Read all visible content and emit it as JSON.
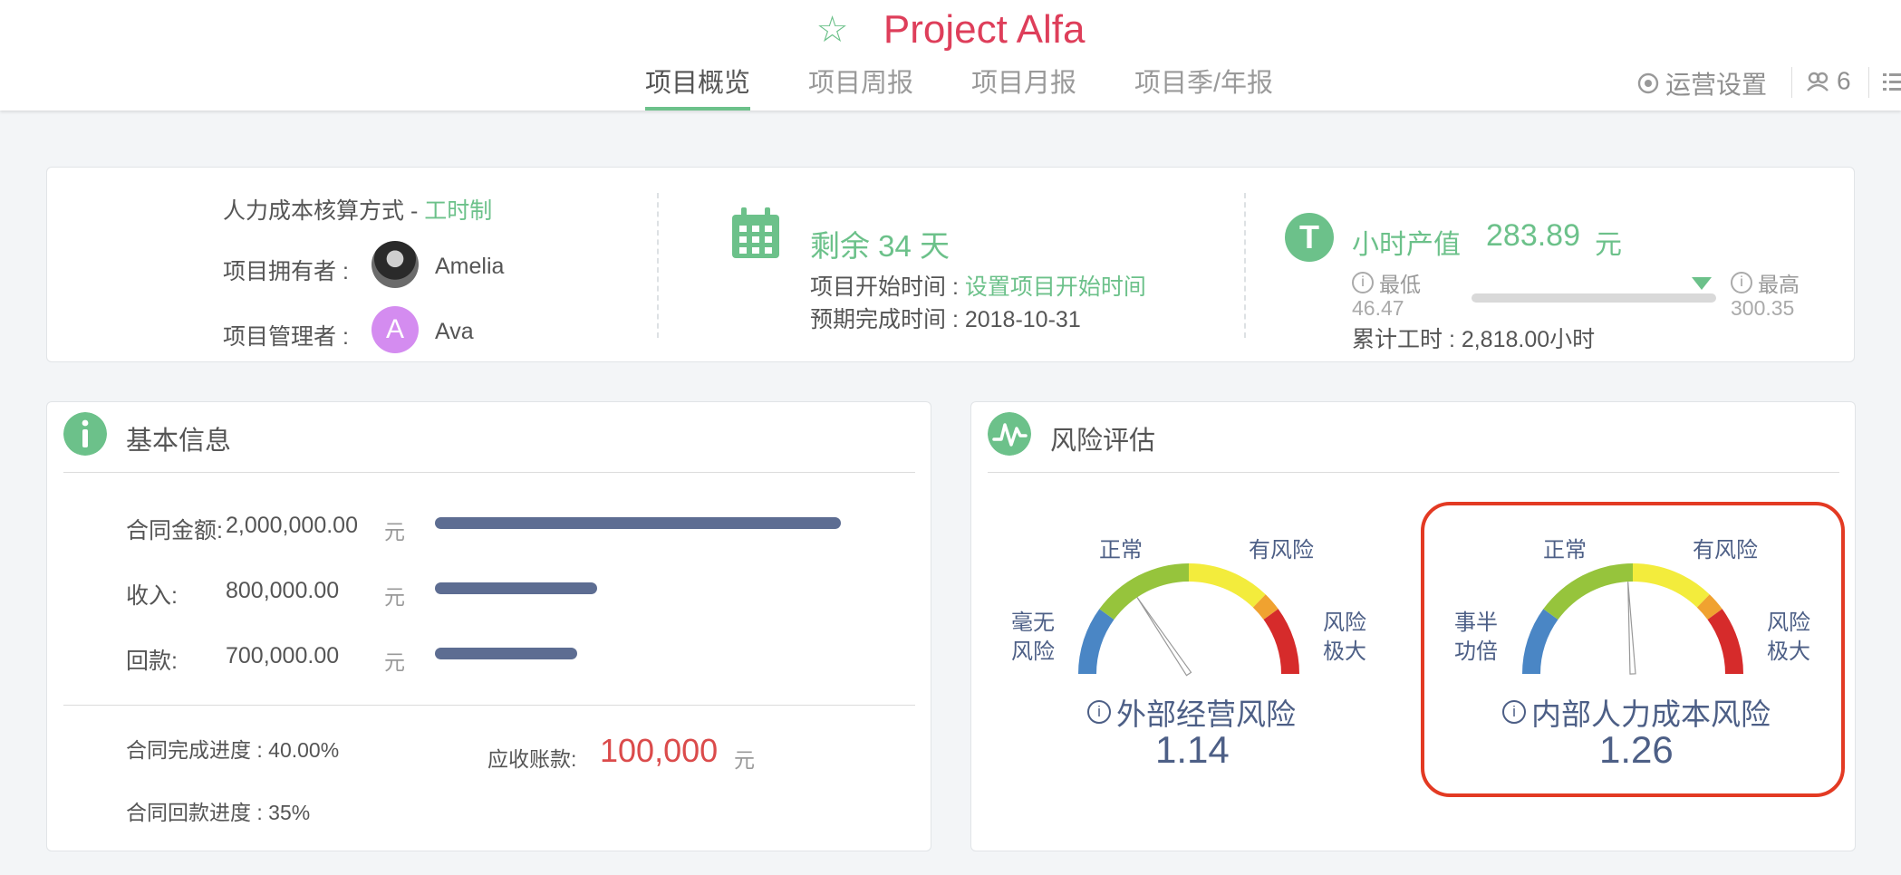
{
  "header": {
    "title": "Project Alfa",
    "tabs": [
      {
        "label": "项目概览",
        "active": true
      },
      {
        "label": "项目周报",
        "active": false
      },
      {
        "label": "项目月报",
        "active": false
      },
      {
        "label": "项目季/年报",
        "active": false
      }
    ],
    "ops_settings_label": "运营设置",
    "member_count": "6"
  },
  "summary": {
    "cost_method_label": "人力成本核算方式 - ",
    "cost_method_value": "工时制",
    "owner_label": "项目拥有者 :",
    "owner_name": "Amelia",
    "manager_label": "项目管理者 :",
    "manager_initial": "A",
    "manager_name": "Ava",
    "remaining": "剩余 34 天",
    "start_label": "项目开始时间 : ",
    "start_link": "设置项目开始时间",
    "due_label": "预期完成时间 : 2018-10-31",
    "hourly_label": "小时产值",
    "hourly_value": "283.89",
    "hourly_unit": "元",
    "min_label": "最低",
    "min_value": "46.47",
    "max_label": "最高",
    "max_value": "300.35",
    "marker_fraction": 0.94,
    "total_hours": "累计工时 : 2,818.00小时"
  },
  "basic_info": {
    "title": "基本信息",
    "rows": [
      {
        "label": "合同金额:",
        "value": "2,000,000.00",
        "unit": "元",
        "fraction": 1.0
      },
      {
        "label": "收入:",
        "value": "800,000.00",
        "unit": "元",
        "fraction": 0.4
      },
      {
        "label": "回款:",
        "value": "700,000.00",
        "unit": "元",
        "fraction": 0.35
      }
    ],
    "contract_progress": "合同完成进度 : 40.00%",
    "payment_progress": "合同回款进度 : 35%",
    "receivable_label": "应收账款:",
    "receivable_value": "100,000",
    "receivable_unit": "元"
  },
  "risk": {
    "title": "风险评估",
    "gauges": [
      {
        "left_label_1": "毫无",
        "left_label_2": "风险",
        "top_left": "正常",
        "top_right": "有风险",
        "right_label_1": "风险",
        "right_label_2": "极大",
        "name": "外部经营风险",
        "value": "1.14",
        "needle_deg": -34
      },
      {
        "left_label_1": "事半",
        "left_label_2": "功倍",
        "top_left": "正常",
        "top_right": "有风险",
        "right_label_1": "风险",
        "right_label_2": "极大",
        "name": "内部人力成本风险",
        "value": "1.26",
        "needle_deg": -3
      }
    ],
    "colors": {
      "blue": "#4a86c5",
      "green": "#96c43c",
      "yellow": "#f3ec3c",
      "orange": "#f0a230",
      "red": "#d62b2b"
    }
  }
}
